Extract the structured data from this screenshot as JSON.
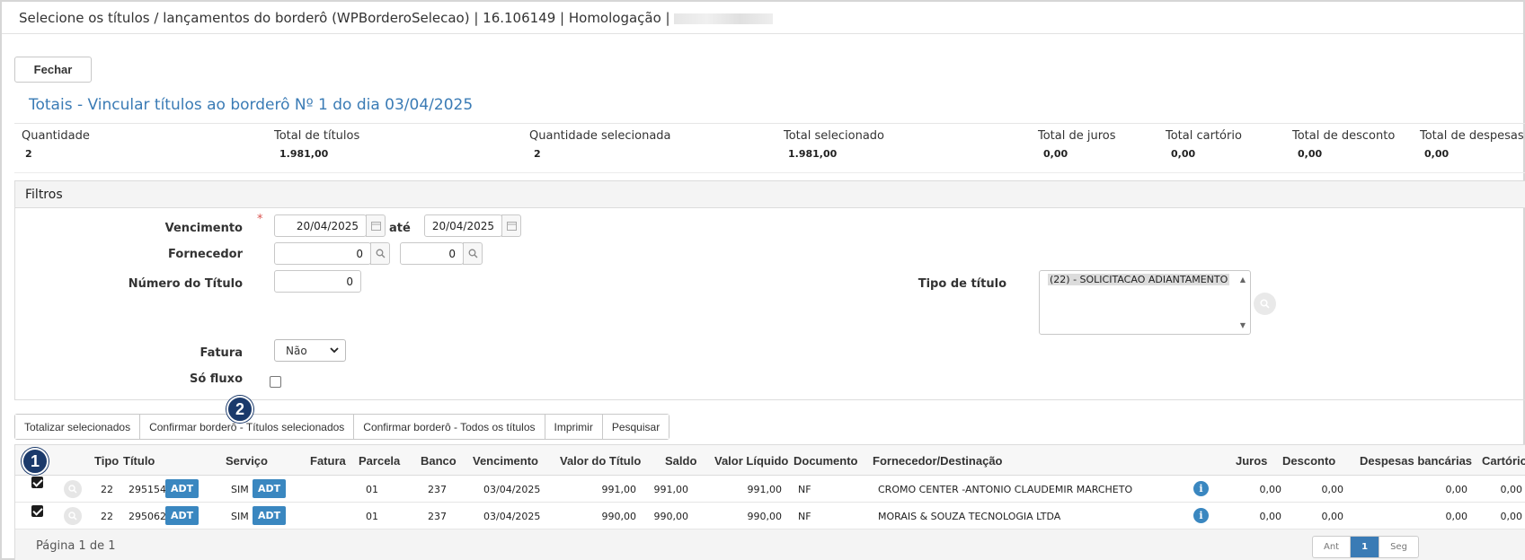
{
  "window": {
    "title": "Selecione os títulos / lançamentos do borderô (WPBorderoSelecao) | 16.106149 | Homologação |"
  },
  "actions": {
    "close_label": "Fechar"
  },
  "totals": {
    "title": "Totais - Vincular títulos ao borderô Nº 1 do dia 03/04/2025",
    "items": [
      {
        "label": "Quantidade",
        "value": "2"
      },
      {
        "label": "Total de títulos",
        "value": "1.981,00"
      },
      {
        "label": "Quantidade selecionada",
        "value": "2"
      },
      {
        "label": "Total selecionado",
        "value": "1.981,00"
      },
      {
        "label": "Total de juros",
        "value": "0,00"
      },
      {
        "label": "Total cartório",
        "value": "0,00"
      },
      {
        "label": "Total de desconto",
        "value": "0,00"
      },
      {
        "label": "Total de despesas",
        "value": "0,00"
      }
    ]
  },
  "filters": {
    "title": "Filtros",
    "vencimento": {
      "label": "Vencimento",
      "required_mark": "*",
      "from": "20/04/2025",
      "separator": "até",
      "to": "20/04/2025"
    },
    "fornecedor": {
      "label": "Fornecedor",
      "from": "0",
      "to": "0"
    },
    "numero_titulo": {
      "label": "Número do Título",
      "value": "0"
    },
    "tipo_titulo": {
      "label": "Tipo de título",
      "options": [
        "(22) - SOLICITACAO ADIANTAMENTO"
      ]
    },
    "fatura": {
      "label": "Fatura",
      "selected": "Não"
    },
    "so_fluxo": {
      "label": "Só fluxo",
      "checked": false
    }
  },
  "toolbar": {
    "buttons": [
      "Totalizar selecionados",
      "Confirmar borderô - Títulos selecionados",
      "Confirmar borderô - Todos os títulos",
      "Imprimir",
      "Pesquisar"
    ]
  },
  "annotations": {
    "badge1": "1",
    "badge2": "2"
  },
  "grid": {
    "columns": [
      "Tipo",
      "Título",
      "Serviço",
      "Fatura",
      "Parcela",
      "Banco",
      "Vencimento",
      "Valor do Título",
      "Saldo",
      "Valor Líquido",
      "Documento",
      "Fornecedor/Destinação",
      "Juros",
      "Desconto",
      "Despesas bancárias",
      "Cartório"
    ],
    "rows": [
      {
        "checked": true,
        "tipo": "22",
        "titulo": "295154",
        "titulo_tag": "ADT",
        "servico": "SIM",
        "servico_tag": "ADT",
        "fatura": "",
        "parcela": "01",
        "banco": "237",
        "vencimento": "03/04/2025",
        "valor_titulo": "991,00",
        "saldo": "991,00",
        "valor_liquido": "991,00",
        "documento": "NF",
        "fornecedor": "CROMO CENTER -ANTONIO CLAUDEMIR MARCHETO",
        "juros": "0,00",
        "desconto": "0,00",
        "despesas": "0,00",
        "cartorio": "0,00"
      },
      {
        "checked": true,
        "tipo": "22",
        "titulo": "295062",
        "titulo_tag": "ADT",
        "servico": "SIM",
        "servico_tag": "ADT",
        "fatura": "",
        "parcela": "01",
        "banco": "237",
        "vencimento": "03/04/2025",
        "valor_titulo": "990,00",
        "saldo": "990,00",
        "valor_liquido": "990,00",
        "documento": "NF",
        "fornecedor": "MORAIS & SOUZA TECNOLOGIA LTDA",
        "juros": "0,00",
        "desconto": "0,00",
        "despesas": "0,00",
        "cartorio": "0,00"
      }
    ],
    "info_glyph": "i",
    "pagination": {
      "info": "Página 1 de 1",
      "prev": "Ant",
      "current": "1",
      "next": "Seg"
    }
  },
  "icons": {
    "calendar": "calendar-icon",
    "search": "search-icon",
    "info": "info-icon",
    "zoom": "zoom-icon"
  },
  "colors": {
    "accent": "#3a7bb5",
    "tag": "#3a87c0",
    "badge": "#1b3a6b",
    "required": "#d9534f"
  }
}
